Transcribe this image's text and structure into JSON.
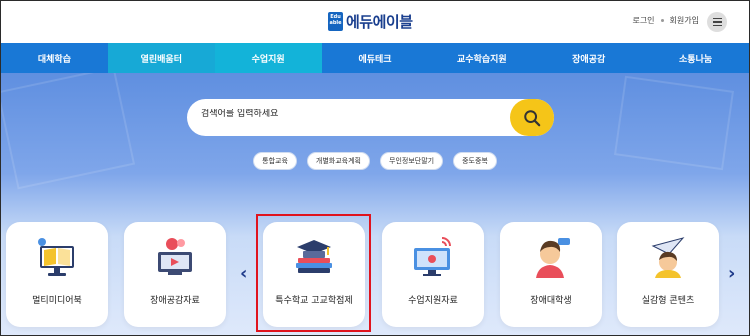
{
  "header": {
    "logo_badge": "Edu able",
    "logo_text": "에듀에이블",
    "login": "로그인",
    "signup": "회원가입"
  },
  "nav": {
    "items": [
      {
        "label": "대체학습"
      },
      {
        "label": "열린배움터"
      },
      {
        "label": "수업지원"
      },
      {
        "label": "에듀테크"
      },
      {
        "label": "교수학습지원"
      },
      {
        "label": "장애공감"
      },
      {
        "label": "소통나눔"
      }
    ]
  },
  "search": {
    "placeholder": "검색어를 입력하세요"
  },
  "tags": [
    "통합교육",
    "개별화교육계획",
    "무인정보단말기",
    "중도중복"
  ],
  "cards": [
    {
      "label": "멀티미디어북",
      "icon": "multimedia-book-icon"
    },
    {
      "label": "장애공감자료",
      "icon": "disability-awareness-icon"
    },
    {
      "label": "특수학교 고교학점제",
      "icon": "graduation-cap-books-icon"
    },
    {
      "label": "수업지원자료",
      "icon": "class-support-monitor-icon"
    },
    {
      "label": "장애대학생",
      "icon": "university-student-icon"
    },
    {
      "label": "실감형 콘텐츠",
      "icon": "immersive-content-icon"
    }
  ],
  "colors": {
    "nav": "#1978d6",
    "nav_alt": "#17a9d6",
    "search_button": "#f5c518",
    "highlight": "#e0141e"
  }
}
